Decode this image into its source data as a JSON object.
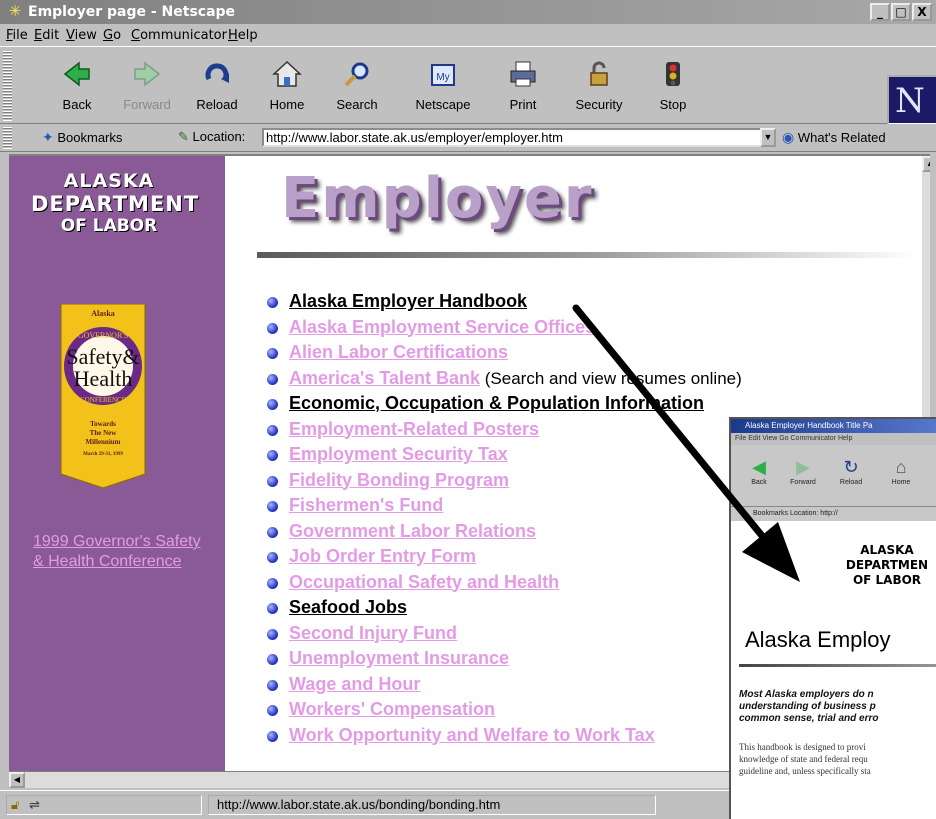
{
  "window": {
    "title": "Employer page - Netscape",
    "minimize": "_",
    "maximize": "□",
    "close": "X"
  },
  "menu": [
    "File",
    "Edit",
    "View",
    "Go",
    "Communicator",
    "Help"
  ],
  "toolbar": {
    "buttons": [
      {
        "label": "Back",
        "icon": "back-arrow-icon",
        "enabled": true
      },
      {
        "label": "Forward",
        "icon": "forward-arrow-icon",
        "enabled": false
      },
      {
        "label": "Reload",
        "icon": "reload-icon",
        "enabled": true
      },
      {
        "label": "Home",
        "icon": "home-icon",
        "enabled": true
      },
      {
        "label": "Search",
        "icon": "search-icon",
        "enabled": true
      },
      {
        "label": "Netscape",
        "icon": "my-netscape-icon",
        "enabled": true
      },
      {
        "label": "Print",
        "icon": "print-icon",
        "enabled": true
      },
      {
        "label": "Security",
        "icon": "lock-icon",
        "enabled": true
      },
      {
        "label": "Stop",
        "icon": "stop-icon",
        "enabled": true
      }
    ],
    "throbber_letter": "N"
  },
  "location_bar": {
    "bookmarks_label": "Bookmarks",
    "location_label": "Location:",
    "url": "http://www.labor.state.ak.us/employer/employer.htm",
    "whats_related_label": "What's Related"
  },
  "sidebar": {
    "logo_lines": [
      "ALASKA",
      "DEPARTMENT",
      "OF LABOR"
    ],
    "badge": {
      "top": "Alaska",
      "arc_top": "GOVERNOR'S",
      "big1": "Safety&",
      "big2": "Health",
      "arc_bottom": "CONFERENCE",
      "tag1": "Towards",
      "tag2": "The New",
      "tag3": "Millennium",
      "dates": "March 29-31, 1999"
    },
    "conference_link": "1999 Governor's Safety & Health Conference"
  },
  "page": {
    "heading": "Employer",
    "links": [
      {
        "text": "Alaska Employer Handbook",
        "visited": true,
        "note": ""
      },
      {
        "text": "Alaska Employment Service Offices",
        "visited": false,
        "note": ""
      },
      {
        "text": "Alien Labor Certifications",
        "visited": false,
        "note": ""
      },
      {
        "text": "America's Talent Bank",
        "visited": false,
        "note": " (Search and view resumes online)"
      },
      {
        "text": "Economic, Occupation & Population Information",
        "visited": true,
        "note": ""
      },
      {
        "text": "Employment-Related Posters",
        "visited": false,
        "note": ""
      },
      {
        "text": "Employment Security Tax",
        "visited": false,
        "note": ""
      },
      {
        "text": "Fidelity Bonding Program",
        "visited": false,
        "note": ""
      },
      {
        "text": "Fishermen's Fund",
        "visited": false,
        "note": ""
      },
      {
        "text": "Government Labor Relations",
        "visited": false,
        "note": ""
      },
      {
        "text": "Job Order Entry Form",
        "visited": false,
        "note": ""
      },
      {
        "text": "Occupational Safety and Health",
        "visited": false,
        "note": ""
      },
      {
        "text": "Seafood Jobs",
        "visited": true,
        "note": ""
      },
      {
        "text": "Second Injury Fund",
        "visited": false,
        "note": ""
      },
      {
        "text": "Unemployment Insurance",
        "visited": false,
        "note": ""
      },
      {
        "text": "Wage and Hour",
        "visited": false,
        "note": ""
      },
      {
        "text": "Workers' Compensation",
        "visited": false,
        "note": ""
      },
      {
        "text": "Work Opportunity and Welfare to Work Tax",
        "visited": false,
        "note": ""
      }
    ]
  },
  "status_bar": {
    "text": "http://www.labor.state.ak.us/bonding/bonding.htm"
  },
  "inset": {
    "title": "Alaska Employer Handbook Title Pa",
    "menu": "File  Edit  View  Go  Communicator  Help",
    "toolbar": [
      "Back",
      "Forward",
      "Reload",
      "Home"
    ],
    "location": "Bookmarks   Location: http://",
    "logo_lines": [
      "ALASKA",
      "DEPARTMEN",
      "OF LABOR"
    ],
    "heading": "Alaska Employ",
    "intro": [
      "Most Alaska employers do n",
      "understanding of business p",
      "common sense, trial and erro"
    ],
    "body": [
      "This handbook is designed to provi",
      "knowledge of state and federal requ",
      "guideline and, unless specifically sta"
    ]
  },
  "colors": {
    "sidebar_bg": "#8a5a96",
    "link_unvisited": "#e39be6",
    "link_visited": "#000000",
    "heading_fill": "#b8a0c8"
  }
}
